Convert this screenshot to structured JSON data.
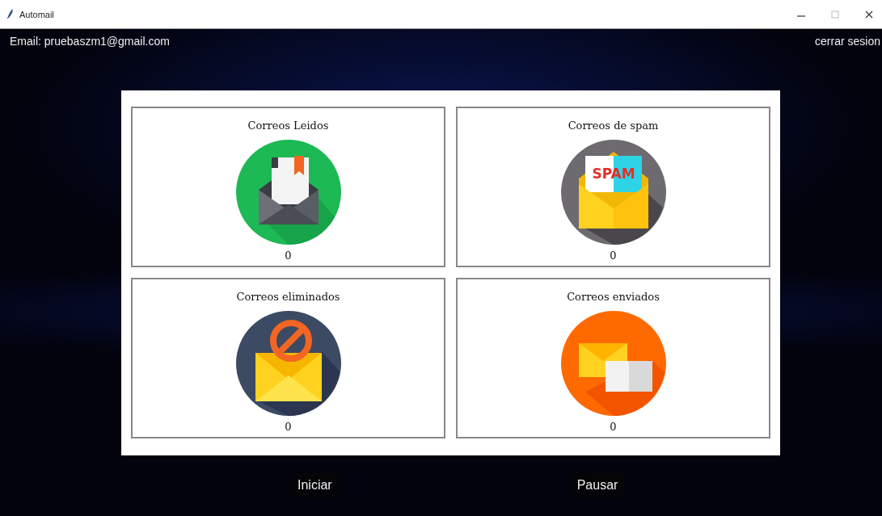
{
  "window": {
    "title": "Automail"
  },
  "header": {
    "email": "Email: pruebaszm1@gmail.com",
    "logout": "cerrar sesion"
  },
  "cards": [
    {
      "kind": "read",
      "title": "Correos Leidos",
      "count": "0"
    },
    {
      "kind": "spam",
      "title": "Correos de spam",
      "count": "0",
      "icon_text": "SPAM"
    },
    {
      "kind": "deleted",
      "title": "Correos eliminados",
      "count": "0"
    },
    {
      "kind": "sent",
      "title": "Correos enviados",
      "count": "0"
    }
  ],
  "buttons": [
    "Iniciar",
    "Pausar"
  ]
}
